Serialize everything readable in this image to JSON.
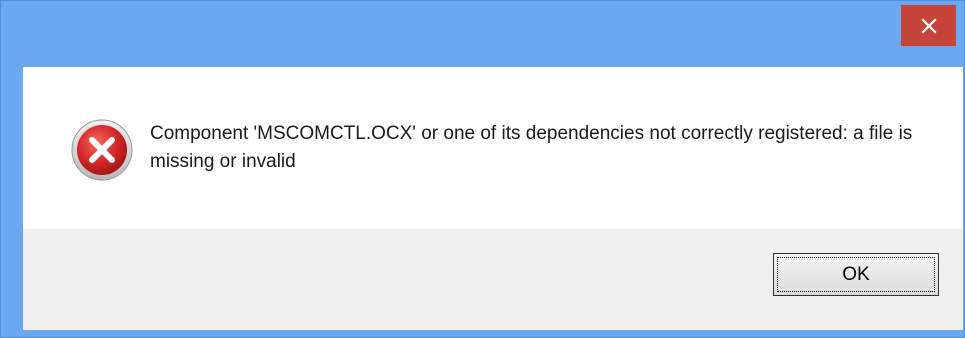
{
  "dialog": {
    "message": "Component 'MSCOMCTL.OCX' or one of its dependencies not correctly registered: a file is missing or invalid",
    "ok_label": "OK",
    "close_glyph": "✕",
    "icons": {
      "close": "close-icon",
      "error": "error-icon"
    },
    "colors": {
      "titlebar": "#6ca8f0",
      "close_button": "#c7443b",
      "footer": "#f0f0f0",
      "error_icon": "#d62828"
    }
  }
}
